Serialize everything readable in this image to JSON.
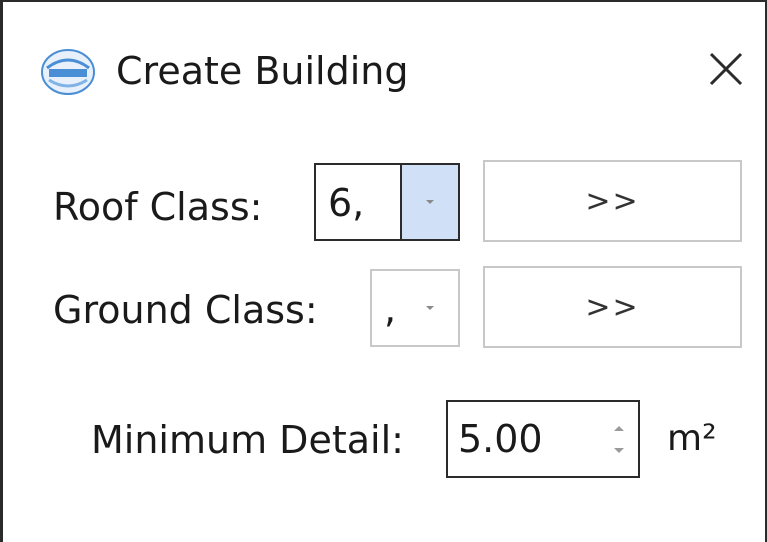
{
  "window": {
    "title": "Create Building",
    "logo_icon": "app-logo-icon",
    "close_icon": "close-icon"
  },
  "roof_class": {
    "label": "Roof Class:",
    "value": "6,",
    "picker_label": ">>"
  },
  "ground_class": {
    "label": "Ground Class:",
    "value": ",",
    "picker_label": ">>"
  },
  "minimum_detail": {
    "label": "Minimum Detail:",
    "value": "5.00",
    "unit": "m²"
  },
  "colors": {
    "border_dark": "#2b2b2b",
    "border_light": "#c8c8c8",
    "dropdown_active": "#cfe0f7",
    "logo_blue": "#4a8fd6"
  }
}
